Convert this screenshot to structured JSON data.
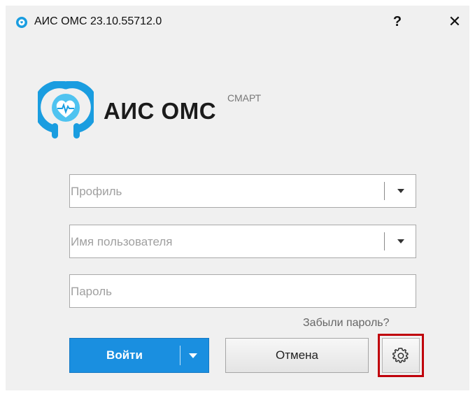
{
  "window": {
    "title": "АИС ОМС 23.10.55712.0",
    "help_label": "?",
    "close_label": "✕"
  },
  "brand": {
    "name": "АИС ОМС",
    "sub": "СМАРТ",
    "accent_color": "#1a8fe0"
  },
  "form": {
    "profile": {
      "placeholder": "Профиль",
      "value": ""
    },
    "username": {
      "placeholder": "Имя пользователя",
      "value": ""
    },
    "password": {
      "placeholder": "Пароль",
      "value": ""
    },
    "forgot_password": "Забыли пароль?"
  },
  "buttons": {
    "login": "Войти",
    "cancel": "Отмена",
    "settings_icon": "gear-icon"
  }
}
